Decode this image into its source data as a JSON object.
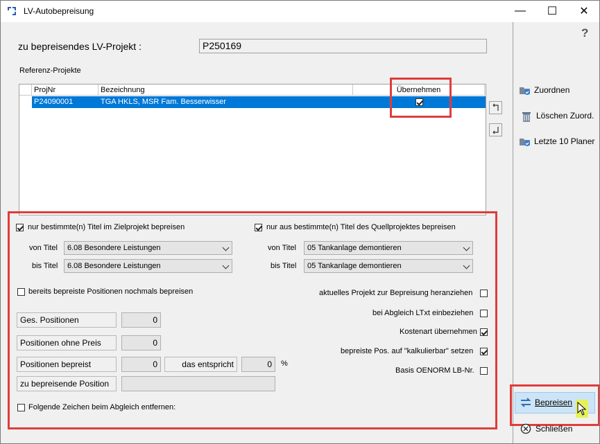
{
  "window": {
    "title": "LV-Autobepreisung",
    "minimize": "—",
    "maximize": "☐",
    "close": "✕"
  },
  "help": "?",
  "project": {
    "label": "zu bepreisendes LV-Projekt :",
    "value": "P250169"
  },
  "reference": {
    "label": "Referenz-Projekte",
    "columns": [
      "ProjNr",
      "Bezeichnung",
      "Übernehmen"
    ],
    "rows": [
      {
        "projnr": "P24090001",
        "bezeichnung": "TGA HKLS, MSR Fam. Besserwisser",
        "uebernehmen": true
      }
    ]
  },
  "options": {
    "ziel_check": "nur bestimmte(n) Titel im Zielprojekt bepreisen",
    "ziel_von_label": "von Titel",
    "ziel_von_value": "6.08  Besondere Leistungen",
    "ziel_bis_label": "bis Titel",
    "ziel_bis_value": "6.08  Besondere Leistungen",
    "quell_check": "nur aus bestimmte(n) Titel des Quellprojektes bepreisen",
    "quell_von_label": "von Titel",
    "quell_von_value": "05   Tankanlage demontieren",
    "quell_bis_label": "bis Titel",
    "quell_bis_value": "05   Tankanlage demontieren",
    "nochmals": "bereits bepreiste Positionen nochmals bepreisen",
    "aktuelles": "aktuelles Projekt zur Bepreisung heranziehen",
    "ltxt": "bei Abgleich LTxt einbeziehen",
    "kostenart": "Kostenart übernehmen",
    "kalkulierbar": "bepreiste Pos. auf \"kalkulierbar\" setzen",
    "oenorm": "Basis OENORM LB-Nr.",
    "zeichen": "Folgende Zeichen beim Abgleich entfernen:"
  },
  "stats": {
    "ges_label": "Ges. Positionen",
    "ges_value": "0",
    "ohne_label": "Positionen ohne Preis",
    "ohne_value": "0",
    "bepreist_label": "Positionen bepreist",
    "bepreist_value": "0",
    "entspricht_label": "das entspricht",
    "entspricht_value": "0",
    "percent": "%",
    "zu_label": "zu bepreisende Position",
    "zu_value": ""
  },
  "side": {
    "zuordnen": "Zuordnen",
    "loeschen": "Löschen Zuord.",
    "letzte": "Letzte 10 Planer",
    "bepreisen": "Bepreisen",
    "schliessen": "Schließen"
  },
  "colors": {
    "accent": "#0078d7",
    "highlight": "#e03c3c"
  }
}
